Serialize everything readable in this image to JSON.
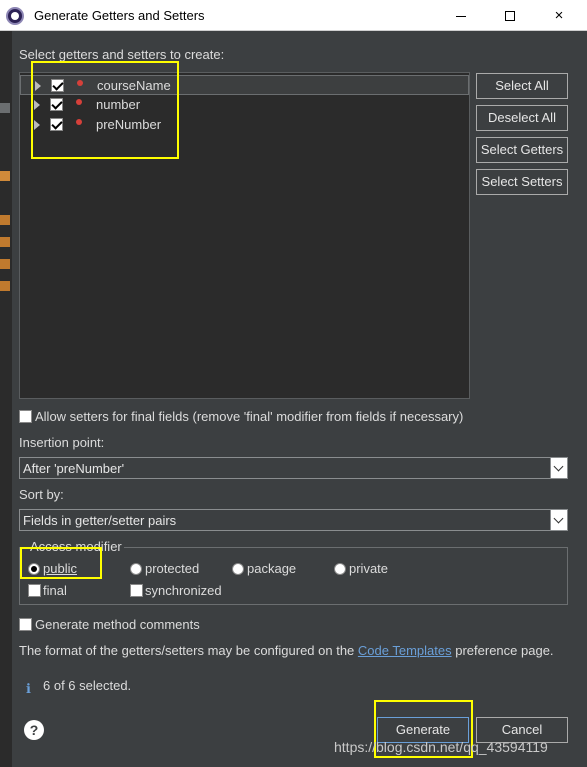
{
  "window": {
    "title": "Generate Getters and Setters",
    "minimize_glyph": "",
    "maximize_glyph": "",
    "close_glyph": "×"
  },
  "prompt": "Select getters and setters to create:",
  "fields": [
    {
      "name": "courseName",
      "checked": true
    },
    {
      "name": "number",
      "checked": true
    },
    {
      "name": "preNumber",
      "checked": true
    }
  ],
  "buttons": {
    "select_all": "Select All",
    "deselect_all": "Deselect All",
    "select_getters": "Select Getters",
    "select_setters": "Select Setters",
    "generate": "Generate",
    "cancel": "Cancel"
  },
  "allow_setters_label": "Allow setters for final fields (remove 'final' modifier from fields if necessary)",
  "insertion_point": {
    "label": "Insertion point:",
    "value": "After 'preNumber'"
  },
  "sort_by": {
    "label": "Sort by:",
    "value": "Fields in getter/setter pairs"
  },
  "access_modifier": {
    "label": "Access modifier",
    "options": [
      "public",
      "protected",
      "package",
      "private"
    ],
    "selected": "public",
    "final_label": "final",
    "synchronized_label": "synchronized"
  },
  "generate_comments_label": "Generate method comments",
  "templates_note": {
    "prefix": "The format of the getters/setters may be configured on the ",
    "link": "Code Templates",
    "suffix": " preference page."
  },
  "status": {
    "icon": "info-icon",
    "text": "6 of 6 selected."
  },
  "help_glyph": "?",
  "watermark": "https://blog.csdn.net/qq_43594119",
  "colors": {
    "background": "#3c3f41",
    "tree_background": "#2b2b2b",
    "highlight": "#ffff00",
    "link": "#6a9fd8"
  }
}
